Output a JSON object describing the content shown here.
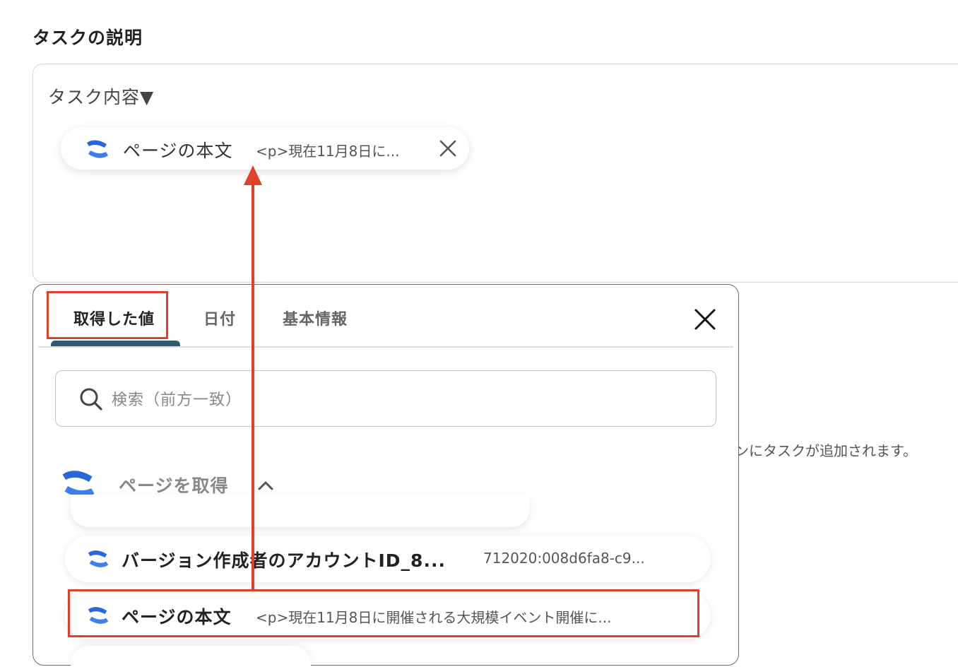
{
  "section": {
    "title": "タスクの説明"
  },
  "description": {
    "text": "タスク内容▼",
    "chip": {
      "title": "ページの本文",
      "value": "<p>現在11月8日に...",
      "logo_icon": "confluence-logo-icon",
      "close_icon": "close-icon"
    }
  },
  "helper_text": "ンにタスクが追加されます。",
  "panel": {
    "tabs": [
      {
        "label": "取得した値",
        "active": true
      },
      {
        "label": "日付",
        "active": false
      },
      {
        "label": "基本情報",
        "active": false
      }
    ],
    "close_icon": "close-icon",
    "search": {
      "placeholder": "検索（前方一致）",
      "value": "",
      "icon": "search-icon"
    },
    "group": {
      "label": "ページを取得",
      "expanded": true,
      "caret_icon": "chevron-up-icon"
    },
    "items": [
      {
        "title": "バージョン作成者のアカウントID_8...",
        "value": "712020:008d6fa8-c9..."
      },
      {
        "title": "ページの本文",
        "value": "<p>現在11月8日に開催される大規模イベント開催に..."
      }
    ]
  },
  "colors": {
    "highlight": "#e0402a",
    "tab_underline": "#2c5a6e",
    "logo_blue": "#2a66d9"
  }
}
